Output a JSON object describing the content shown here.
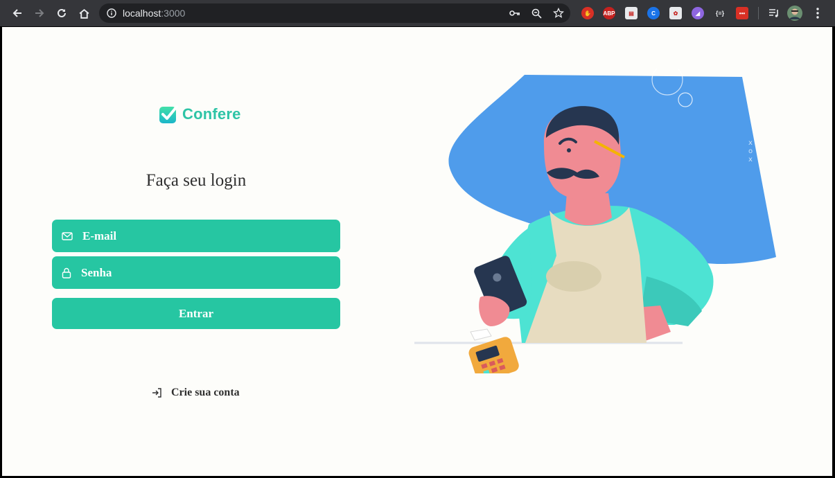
{
  "browser": {
    "url_host": "localhost",
    "url_port": ":3000"
  },
  "app": {
    "brand_name": "Confere",
    "brand_color": "#2ec4a6",
    "accent_color": "#26c6a2"
  },
  "login": {
    "title": "Faça seu login",
    "email_placeholder": "E-mail",
    "password_placeholder": "Senha",
    "submit_label": "Entrar",
    "signup_label": "Crie sua conta"
  }
}
